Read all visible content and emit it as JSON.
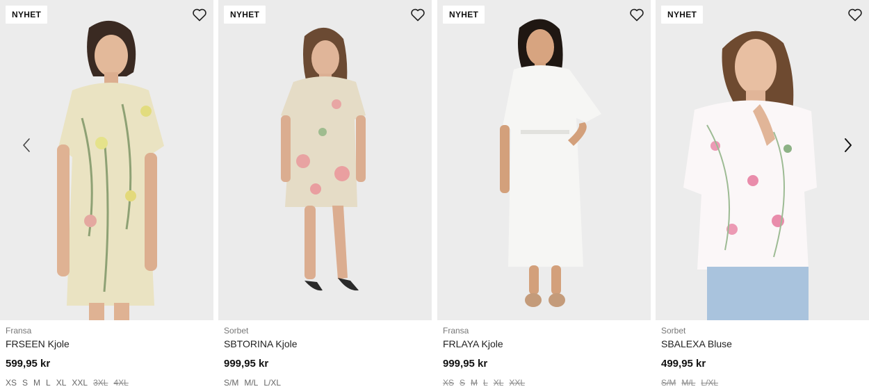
{
  "colors": {
    "photo_bg": "#ebebeb",
    "badge_bg": "#ffffff",
    "price": "#111111",
    "unavailable_size": "#8a8a8a"
  },
  "carousel": {
    "prev_icon": "chevron-left-icon",
    "next_icon": "chevron-right-icon"
  },
  "products": [
    {
      "badge": "NYHET",
      "brand": "Fransa",
      "name": "FRSEEN Kjole",
      "price": "599,95 kr",
      "sizes": [
        {
          "label": "XS",
          "available": true
        },
        {
          "label": "S",
          "available": true
        },
        {
          "label": "M",
          "available": true
        },
        {
          "label": "L",
          "available": true
        },
        {
          "label": "XL",
          "available": true
        },
        {
          "label": "XXL",
          "available": true
        },
        {
          "label": "3XL",
          "available": false
        },
        {
          "label": "4XL",
          "available": false
        }
      ]
    },
    {
      "badge": "NYHET",
      "brand": "Sorbet",
      "name": "SBTORINA Kjole",
      "price": "999,95 kr",
      "sizes": [
        {
          "label": "S/M",
          "available": true
        },
        {
          "label": "M/L",
          "available": true
        },
        {
          "label": "L/XL",
          "available": true
        }
      ]
    },
    {
      "badge": "NYHET",
      "brand": "Fransa",
      "name": "FRLAYA Kjole",
      "price": "999,95 kr",
      "sizes": [
        {
          "label": "XS",
          "available": false
        },
        {
          "label": "S",
          "available": false
        },
        {
          "label": "M",
          "available": false
        },
        {
          "label": "L",
          "available": false
        },
        {
          "label": "XL",
          "available": false
        },
        {
          "label": "XXL",
          "available": false
        }
      ]
    },
    {
      "badge": "NYHET",
      "brand": "Sorbet",
      "name": "SBALEXA Bluse",
      "price": "499,95 kr",
      "sizes": [
        {
          "label": "S/M",
          "available": false
        },
        {
          "label": "M/L",
          "available": false
        },
        {
          "label": "L/XL",
          "available": false
        }
      ]
    }
  ]
}
